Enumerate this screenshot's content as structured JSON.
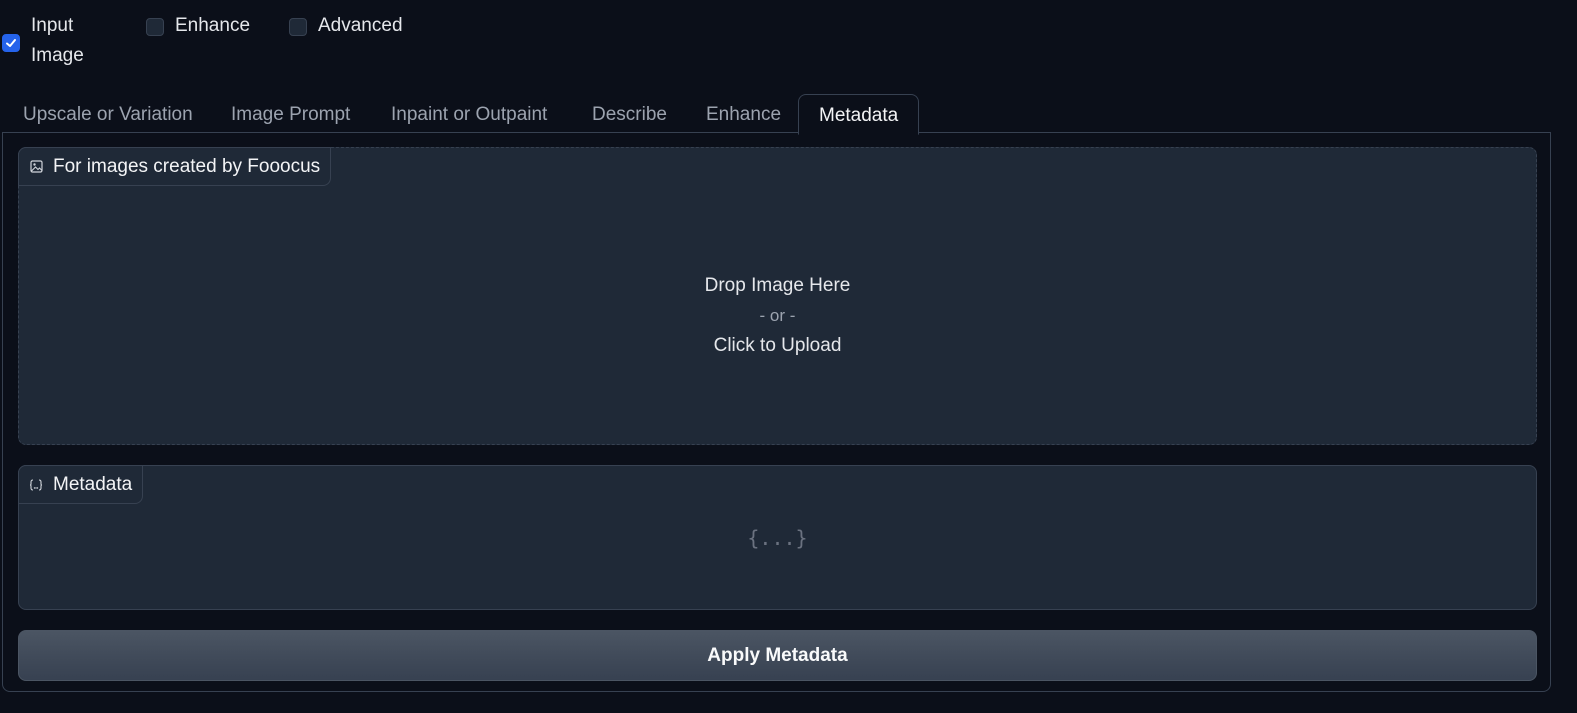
{
  "options": {
    "input_image": {
      "label": "Input Image",
      "checked": true
    },
    "enhance": {
      "label": "Enhance",
      "checked": false
    },
    "advanced": {
      "label": "Advanced",
      "checked": false
    }
  },
  "tabs": [
    {
      "label": "Upscale or Variation",
      "active": false
    },
    {
      "label": "Image Prompt",
      "active": false
    },
    {
      "label": "Inpaint or Outpaint",
      "active": false
    },
    {
      "label": "Describe",
      "active": false
    },
    {
      "label": "Enhance",
      "active": false
    },
    {
      "label": "Metadata",
      "active": true
    }
  ],
  "image_upload": {
    "label": "For images created by Fooocus",
    "icon": "image-icon",
    "drop_text": "Drop Image Here",
    "or_text": "- or -",
    "click_text": "Click to Upload"
  },
  "metadata": {
    "label": "Metadata",
    "icon": "json-icon",
    "empty_text": "{...}"
  },
  "apply_button": {
    "label": "Apply Metadata"
  },
  "colors": {
    "background": "#0b0f19",
    "panel": "#1f2937",
    "border": "#374151",
    "accent": "#2563eb"
  }
}
